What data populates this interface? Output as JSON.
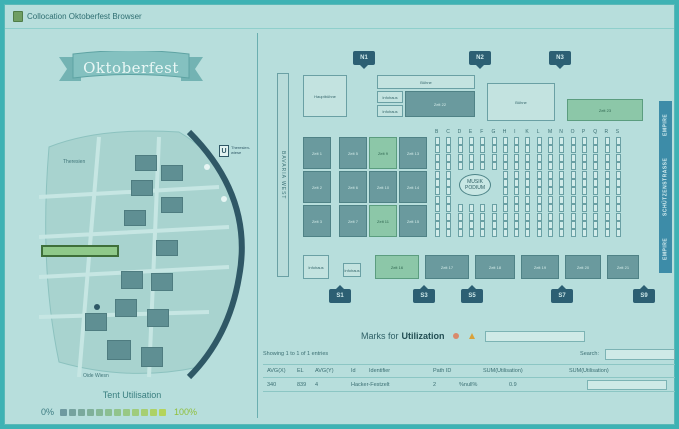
{
  "app": {
    "title": "Collocation Oktoberfest Browser"
  },
  "left_panel": {
    "banner": "Oktoberfest",
    "map_labels": {
      "theresien": "Theresien",
      "ubahn": "U",
      "ubahn_station": "Theresien-wiese",
      "ort": "Oide Wiesn"
    },
    "util_title": "Tent Utilisation",
    "util_low": "0%",
    "util_high": "100%"
  },
  "plan": {
    "gates_top": [
      "N1",
      "N2",
      "N3"
    ],
    "gates_bottom": [
      "S1",
      "S3",
      "S5",
      "S7",
      "S9"
    ],
    "stall_letters": [
      "B",
      "C",
      "D",
      "E",
      "F",
      "G",
      "H",
      "I",
      "K",
      "L",
      "M",
      "N",
      "O",
      "P",
      "Q",
      "R",
      "S"
    ],
    "podium": "MUSIK PODIUM",
    "west_label": "BAVARIA WEST",
    "east_labels": [
      "EMPIRE",
      "SCHÜTZENSTRASSE",
      "EMPIRE"
    ],
    "info_boxes": [
      "Bühne",
      "Hauptbühne",
      "Infohaus"
    ],
    "tents_grid": [
      [
        "Zelt 1",
        "Zelt 5",
        "Zelt 9",
        "Zelt 13"
      ],
      [
        "Zelt 2",
        "Zelt 6",
        "Zelt 10",
        "Zelt 14"
      ],
      [
        "Zelt 3",
        "Zelt 7",
        "Zelt 11",
        "Zelt 15"
      ]
    ],
    "tents_bottom": [
      "Zelt 16",
      "Zelt 17",
      "Zelt 18",
      "Zelt 19",
      "Zelt 20",
      "Zelt 21"
    ],
    "top_tents": [
      "Zelt 22",
      "Zelt 23"
    ]
  },
  "marks": {
    "prefix": "Marks for",
    "field": "Utilization"
  },
  "table": {
    "info": "Showing 1 to 1 of 1 entries",
    "search_label": "Search:",
    "headers": [
      "AVG(X)",
      "EL",
      "AVG(Y)",
      "Id",
      "Identifier",
      "Path ID",
      "SUM(Utilisation)",
      "SUM(Utilisation)"
    ],
    "row": [
      "340",
      "839",
      "4",
      "Hacker-Festzelt",
      "2",
      "%null%",
      "0.9",
      ""
    ]
  },
  "colors": {
    "accent": "#3eb2b4",
    "tent": "#6a9a9e",
    "tent_green": "#8cc7a8",
    "gate": "#2c5f73"
  }
}
